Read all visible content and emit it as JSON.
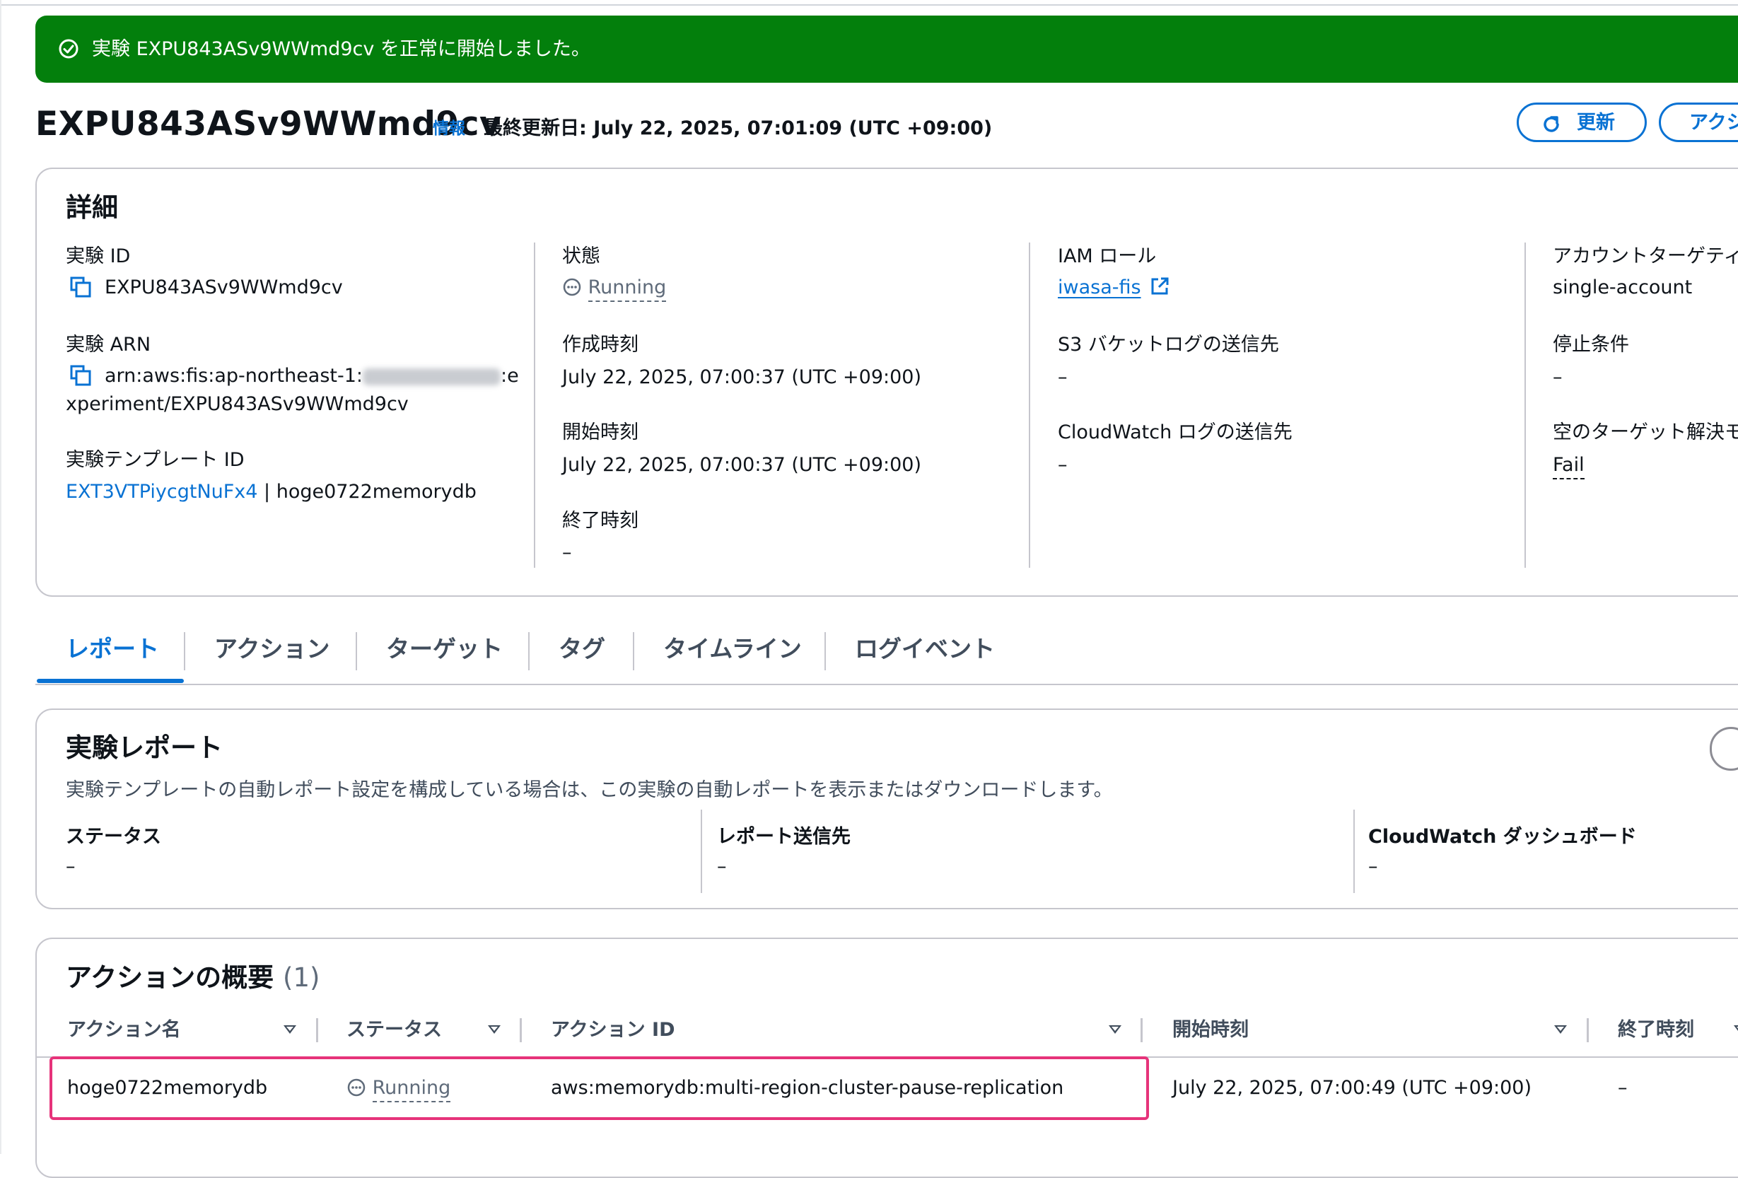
{
  "flash": {
    "icon": "check-circle-icon",
    "message": "実験 EXPU843ASv9WWmd9cv を正常に開始しました。"
  },
  "header": {
    "title": "EXPU843ASv9WWmd9cv",
    "info_label": "情報",
    "last_updated": "最終更新日: July 22, 2025, 07:01:09 (UTC +09:00)",
    "refresh_label": "更新",
    "actions_label": "アクショ"
  },
  "details": {
    "title": "詳細",
    "experiment_id_label": "実験 ID",
    "experiment_id": "EXPU843ASv9WWmd9cv",
    "arn_label": "実験 ARN",
    "arn_line1_prefix": "arn:aws:fis:ap-northeast-1:",
    "arn_line1_suffix": ":e",
    "arn_line2": "xperiment/EXPU843ASv9WWmd9cv",
    "template_label": "実験テンプレート ID",
    "template_id": "EXT3VTPiycgtNuFx4",
    "template_name": " | hoge0722memorydb",
    "state_label": "状態",
    "state": "Running",
    "created_label": "作成時刻",
    "created": "July 22, 2025, 07:00:37 (UTC +09:00)",
    "started_label": "開始時刻",
    "started": "July 22, 2025, 07:00:37 (UTC +09:00)",
    "ended_label": "終了時刻",
    "ended": "–",
    "iam_label": "IAM ロール",
    "iam_role": "iwasa-fis",
    "s3_label": "S3 バケットログの送信先",
    "s3": "–",
    "cw_label": "CloudWatch ログの送信先",
    "cw": "–",
    "account_label": "アカウントターゲティ",
    "account": "single-account",
    "stop_label": "停止条件",
    "stop": "–",
    "empty_label": "空のターゲット解決モ",
    "empty": "Fail"
  },
  "tabs": [
    "レポート",
    "アクション",
    "ターゲット",
    "タグ",
    "タイムライン",
    "ログイベント"
  ],
  "report": {
    "title": "実験レポート",
    "description": "実験テンプレートの自動レポート設定を構成している場合は、この実験の自動レポートを表示またはダウンロードします。",
    "status_label": "ステータス",
    "status": "–",
    "destination_label": "レポート送信先",
    "destination": "–",
    "dashboard_label": "CloudWatch ダッシュボード",
    "dashboard": "–"
  },
  "actions_summary": {
    "title": "アクションの概要",
    "count": "(1)",
    "columns": [
      "アクション名",
      "ステータス",
      "アクション ID",
      "開始時刻",
      "終了時刻"
    ],
    "rows": [
      {
        "name": "hoge0722memorydb",
        "status": "Running",
        "action_id": "aws:memorydb:multi-region-cluster-pause-replication",
        "start": "July 22, 2025, 07:00:49 (UTC +09:00)",
        "end": "–"
      }
    ]
  },
  "colors": {
    "success": "#037f0c",
    "link": "#0972d3",
    "highlight": "#e6337a"
  }
}
